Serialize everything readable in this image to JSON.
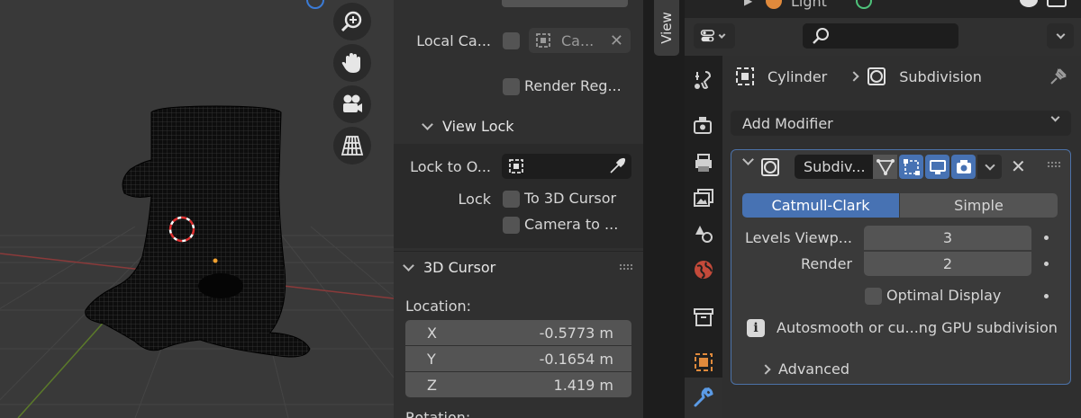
{
  "view_tab": {
    "label": "View"
  },
  "npanel": {
    "local_camera": {
      "label": "Local Ca...",
      "value": "Ca..."
    },
    "render_region": {
      "label": "Render Reg..."
    },
    "view_lock": {
      "title": "View Lock",
      "lock_to_object_label": "Lock to O...",
      "lock_label": "Lock",
      "to_3d_cursor_label": "To 3D Cursor",
      "camera_to_view_label": "Camera to ..."
    },
    "cursor": {
      "title": "3D Cursor",
      "location_label": "Location:",
      "x_label": "X",
      "x_value": "-0.5773 m",
      "y_label": "Y",
      "y_value": "-0.1654 m",
      "z_label": "Z",
      "z_value": "1.419 m",
      "rotation_label": "Rotation:"
    }
  },
  "outliner": {
    "light_label": "Light"
  },
  "properties": {
    "breadcrumb": {
      "object": "Cylinder",
      "modifier": "Subdivision"
    },
    "add_modifier": "Add Modifier",
    "modifier": {
      "name": "Subdiv...",
      "algorithm_options": [
        "Catmull-Clark",
        "Simple"
      ],
      "selected_algorithm": "Catmull-Clark",
      "levels_viewport_label": "Levels Viewp...",
      "levels_viewport_value": "3",
      "render_label": "Render",
      "render_value": "2",
      "optimal_display_label": "Optimal Display",
      "info_text": "Autosmooth or cu...ng GPU subdivision",
      "advanced_label": "Advanced"
    }
  },
  "colors": {
    "accent_blue": "#4772b3",
    "panel_bg": "#303030",
    "field_bg": "#545454",
    "cursor_red": "#e03030",
    "origin_orange": "#f0a030",
    "axis_red": "#8a3a3a",
    "axis_green": "#5b7a2a"
  }
}
